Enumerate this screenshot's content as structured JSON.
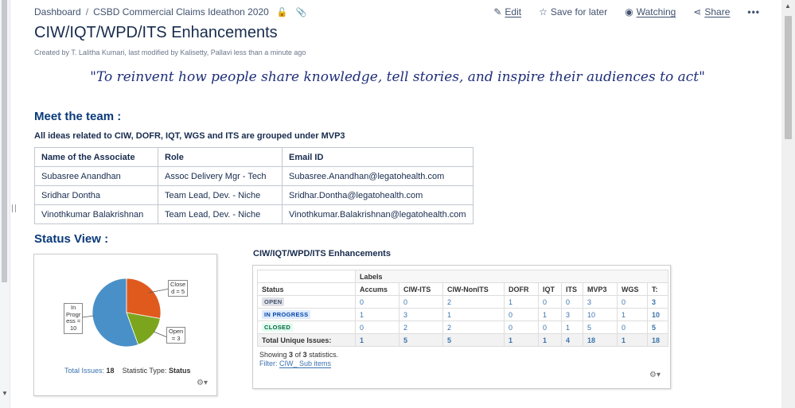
{
  "breadcrumb": {
    "items": [
      "Dashboard",
      "CSBD Commercial Claims Ideathon 2020"
    ]
  },
  "actions": {
    "edit": "Edit",
    "save": "Save for later",
    "watching": "Watching",
    "share": "Share",
    "more": "•••"
  },
  "page": {
    "title": "CIW/IQT/WPD/ITS Enhancements",
    "byline": "Created by T. Lalitha Kumari, last modified by Kalisetty, Pallavi less than a minute ago",
    "quote": "\"To reinvent how people share knowledge, tell stories, and inspire their audiences to act\""
  },
  "team": {
    "heading": "Meet the team :",
    "note": "All ideas related to CIW, DOFR, IQT, WGS and ITS are grouped under MVP3",
    "headers": [
      "Name of the Associate",
      "Role",
      "Email ID"
    ],
    "rows": [
      [
        "Subasree Anandhan",
        "Assoc Delivery Mgr - Tech",
        "Subasree.Anandhan@legatohealth.com"
      ],
      [
        "Sridhar Dontha",
        "Team Lead, Dev. - Niche",
        "Sridhar.Dontha@legatohealth.com"
      ],
      [
        "Vinothkumar Balakrishnan",
        "Team Lead, Dev. - Niche",
        "Vinothkumar.Balakrishnan@legatohealth.com"
      ]
    ]
  },
  "status": {
    "heading": "Status View :",
    "pie": {
      "labels": {
        "inprogress": [
          "In",
          "Progr",
          "ess =",
          "10"
        ],
        "closed": [
          "Close",
          "d = 5"
        ],
        "open": [
          "Open",
          "= 3"
        ]
      },
      "total_label": "Total Issues:",
      "total": "18",
      "stat_label": "Statistic Type:",
      "stat_value": "Status"
    },
    "stats": {
      "title": "CIW/IQT/WPD/ITS Enhancements",
      "group_label": "Labels",
      "status_col": "Status",
      "columns": [
        "Accums",
        "CIW-ITS",
        "CIW-NonITS",
        "DOFR",
        "IQT",
        "ITS",
        "MVP3",
        "WGS",
        "T:"
      ],
      "rows": [
        {
          "status": "OPEN",
          "values": [
            "0",
            "0",
            "2",
            "1",
            "0",
            "0",
            "3",
            "0",
            "3"
          ]
        },
        {
          "status": "IN PROGRESS",
          "values": [
            "1",
            "3",
            "1",
            "0",
            "1",
            "3",
            "10",
            "1",
            "10"
          ]
        },
        {
          "status": "CLOSED",
          "values": [
            "0",
            "2",
            "2",
            "0",
            "0",
            "1",
            "5",
            "0",
            "5"
          ]
        }
      ],
      "total_label": "Total Unique Issues:",
      "totals": [
        "1",
        "5",
        "5",
        "1",
        "1",
        "4",
        "18",
        "1",
        "18"
      ],
      "showing_prefix": "Showing",
      "showing_count": "3",
      "showing_of": "of",
      "showing_total": "3",
      "showing_suffix": "statistics.",
      "filter_label": "Filter:",
      "filter_value": "CIW_ Sub items"
    }
  },
  "chart_data": {
    "type": "pie",
    "categories": [
      "In Progress",
      "Closed",
      "Open"
    ],
    "values": [
      10,
      5,
      3
    ],
    "colors": [
      "#4a90c8",
      "#e05a1e",
      "#7aa51c"
    ]
  }
}
